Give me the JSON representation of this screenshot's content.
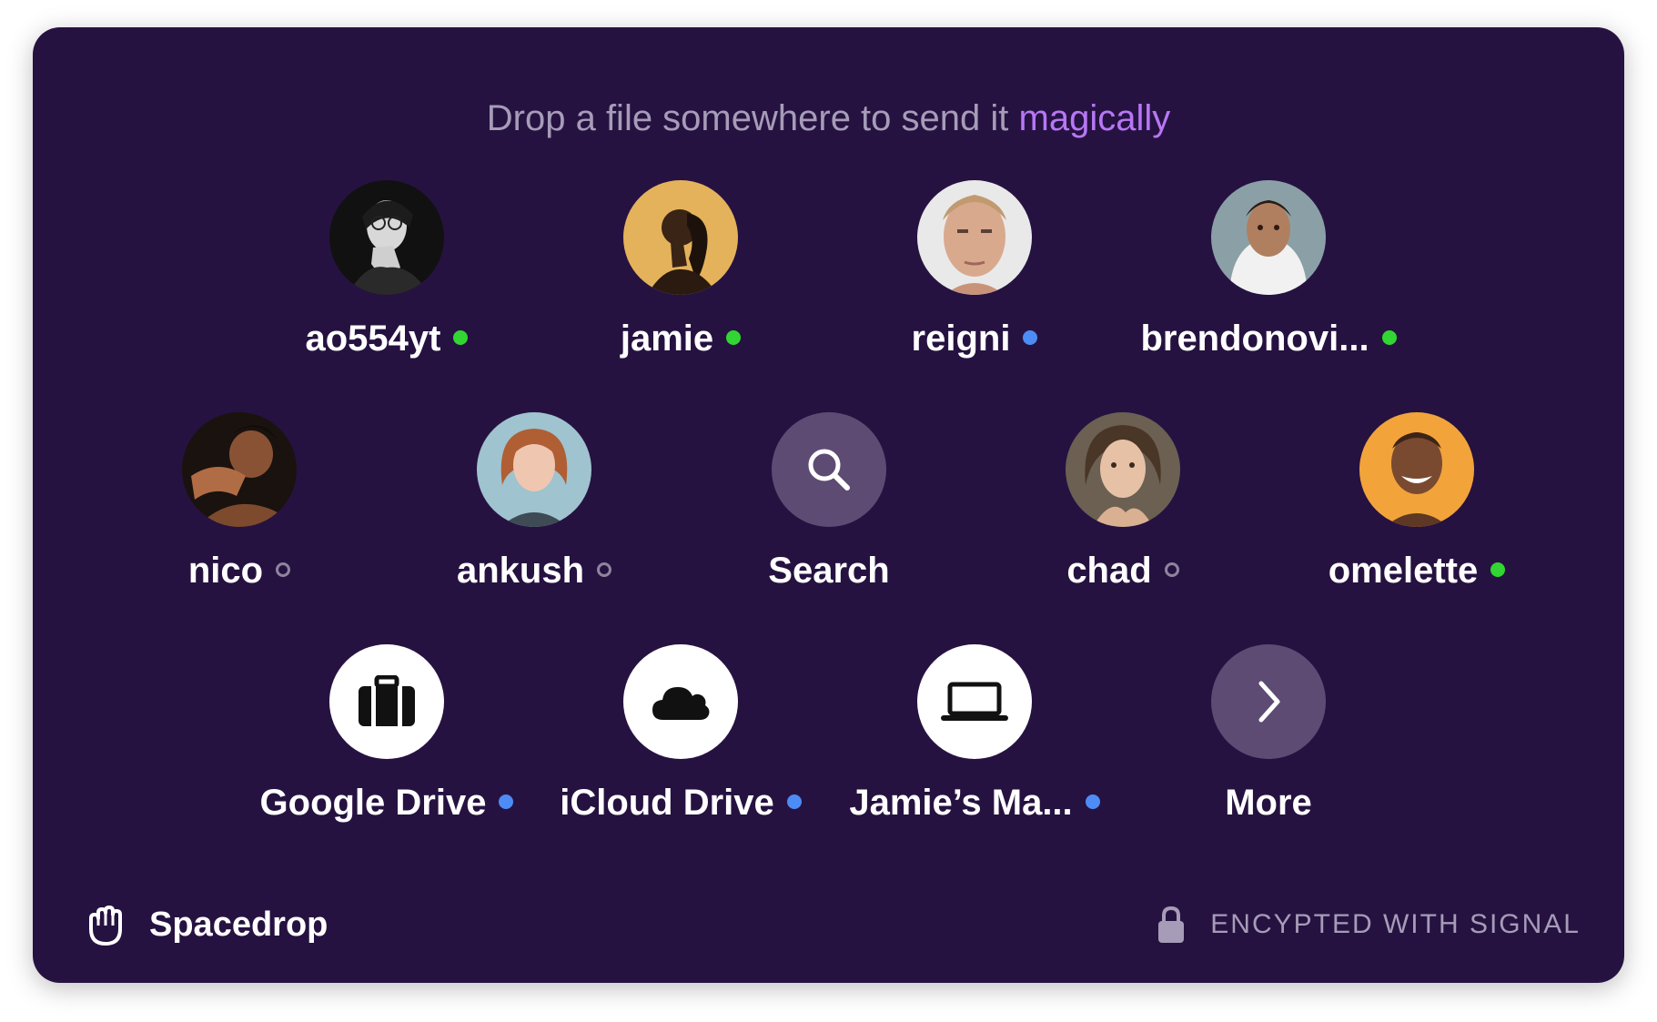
{
  "header": {
    "prefix": "Drop a file somewhere to send it ",
    "accent_word": "magically"
  },
  "colors": {
    "panel_bg": "#261241",
    "accent": "#b777f4",
    "online": "#32d632",
    "device": "#4d8cf5",
    "offline": "#8e849e"
  },
  "contacts": [
    {
      "name": "ao554yt",
      "status": "online"
    },
    {
      "name": "jamie",
      "status": "online"
    },
    {
      "name": "reigni",
      "status": "device"
    },
    {
      "name": "brendonovi...",
      "status": "online"
    },
    {
      "name": "nico",
      "status": "offline"
    },
    {
      "name": "ankush",
      "status": "offline"
    },
    {
      "name": "chad",
      "status": "offline"
    },
    {
      "name": "omelette",
      "status": "online"
    }
  ],
  "search": {
    "label": "Search",
    "icon": "search-icon"
  },
  "destinations": [
    {
      "name": "Google Drive",
      "status": "device",
      "icon": "briefcase-icon"
    },
    {
      "name": "iCloud Drive",
      "status": "device",
      "icon": "cloud-icon"
    },
    {
      "name": "Jamie’s Ma...",
      "status": "device",
      "icon": "laptop-icon"
    }
  ],
  "more": {
    "label": "More",
    "icon": "chevron-right-icon"
  },
  "footer": {
    "brand": "Spacedrop",
    "brand_icon": "hand-icon",
    "security_text": "ENCYPTED WITH SIGNAL",
    "security_icon": "lock-icon"
  }
}
